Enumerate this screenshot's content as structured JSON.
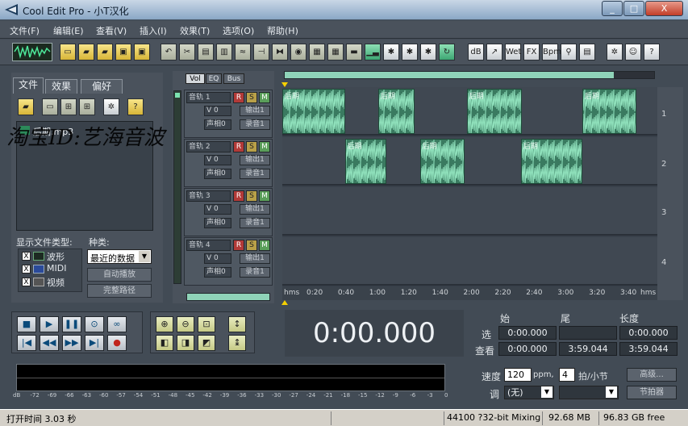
{
  "window": {
    "title": "Cool Edit Pro  - 小T汉化",
    "min": "_",
    "max": "□",
    "close": "X"
  },
  "menu": [
    "文件(F)",
    "编辑(E)",
    "查看(V)",
    "插入(I)",
    "效果(T)",
    "选项(O)",
    "帮助(H)"
  ],
  "toolbar": {
    "icons": [
      "waveform-toggle-icon",
      "new-file-icon",
      "open-file-icon",
      "open-append-icon",
      "save-icon",
      "save-all-icon",
      "undo-icon",
      "cut-icon",
      "copy-icon",
      "paste-icon",
      "mix-paste-icon",
      "trim-icon",
      "silence-icon",
      "noise-icon",
      "loop-icon",
      "repeat-icon",
      "frequency-icon",
      "spectral-icon",
      "cue-icon",
      "snap-icon",
      "mix-icon",
      "normalize-icon",
      "amplify-icon",
      "envelope-icon",
      "reverb-icon",
      "eq-icon",
      "pitch-icon",
      "bpm-icon",
      "tempo-icon",
      "cd-icon",
      "script-icon",
      "effects-icon",
      "help-icon"
    ],
    "labels": {
      "amp": "dB",
      "wet": "Wet",
      "fx": "FX",
      "bpm": "Bpm"
    }
  },
  "left_panel": {
    "tabs": [
      "文件",
      "效果",
      "偏好"
    ],
    "files": [
      "后期.mp3"
    ],
    "show_types_label": "显示文件类型:",
    "types": [
      {
        "label": "波形",
        "checked": "X"
      },
      {
        "label": "MIDI",
        "checked": "X"
      },
      {
        "label": "视频",
        "checked": "X"
      }
    ],
    "sort_label": "种类:",
    "sort_value": "最近的数据",
    "auto_play": "自动播放",
    "full_path": "完整路径"
  },
  "watermark": "淘宝ID:艺海音波",
  "mixer_tabs": [
    "Vol",
    "EQ",
    "Bus"
  ],
  "tracks": [
    {
      "name": "音轨 1",
      "vol": "V 0",
      "pan": "声相0",
      "out": "输出1",
      "rec": "录音1",
      "num": "1"
    },
    {
      "name": "音轨 2",
      "vol": "V 0",
      "pan": "声相0",
      "out": "输出1",
      "rec": "录音1",
      "num": "2"
    },
    {
      "name": "音轨 3",
      "vol": "V 0",
      "pan": "声相0",
      "out": "输出1",
      "rec": "录音1",
      "num": "3"
    },
    {
      "name": "音轨 4",
      "vol": "V 0",
      "pan": "声相0",
      "out": "输出1",
      "rec": "录音1",
      "num": "4"
    }
  ],
  "track_buttons": {
    "r": "R",
    "s": "S",
    "m": "M"
  },
  "clips": [
    {
      "track": 1,
      "label": "后期",
      "start": 0,
      "end": 60
    },
    {
      "track": 1,
      "label": "后期",
      "start": 92,
      "end": 127
    },
    {
      "track": 1,
      "label": "后期",
      "start": 177,
      "end": 230
    },
    {
      "track": 1,
      "label": "后期",
      "start": 288,
      "end": 340
    },
    {
      "track": 2,
      "label": "后期",
      "start": 60,
      "end": 100
    },
    {
      "track": 2,
      "label": "后期",
      "start": 132,
      "end": 175
    },
    {
      "track": 2,
      "label": "后期",
      "start": 229,
      "end": 288
    }
  ],
  "timeline": {
    "unit": "hms",
    "ticks": [
      "0:20",
      "0:40",
      "1:00",
      "1:20",
      "1:40",
      "2:00",
      "2:20",
      "2:40",
      "3:00",
      "3:20",
      "3:40"
    ],
    "end_unit": "hms"
  },
  "overview_fill_pct": 89,
  "transport": {
    "stop": "■",
    "play": "▶",
    "pause": "❚❚",
    "play_loop": "⊙",
    "loop": "∞",
    "go_start": "|◀",
    "rewind": "◀◀",
    "forward": "▶▶",
    "go_end": "▶|",
    "record": "●"
  },
  "time_display": "0:00.000",
  "selection": {
    "headers": {
      "start": "始",
      "end": "尾",
      "length": "长度"
    },
    "rows": [
      {
        "label": "选",
        "start": "0:00.000",
        "end": "",
        "length": "0:00.000"
      },
      {
        "label": "查看",
        "start": "0:00.000",
        "end": "3:59.044",
        "length": "3:59.044"
      }
    ]
  },
  "meter_scale": [
    "dB",
    "-72",
    "-69",
    "-66",
    "-63",
    "-60",
    "-57",
    "-54",
    "-51",
    "-48",
    "-45",
    "-42",
    "-39",
    "-36",
    "-33",
    "-30",
    "-27",
    "-24",
    "-21",
    "-18",
    "-15",
    "-12",
    "-9",
    "-6",
    "-3",
    "0"
  ],
  "tempo": {
    "speed_label": "速度",
    "speed": "120",
    "bpm_unit": "ppm,",
    "beats": "4",
    "beats_unit": "拍/小节",
    "advanced": "高级...",
    "key_label": "调",
    "key": "(无)",
    "metronome": "节拍器"
  },
  "status": {
    "open_time": "打开时间  3.03 秒",
    "format": "44100 ?32-bit Mixing",
    "mem": "92.68 MB",
    "disk": "96.83 GB free"
  }
}
